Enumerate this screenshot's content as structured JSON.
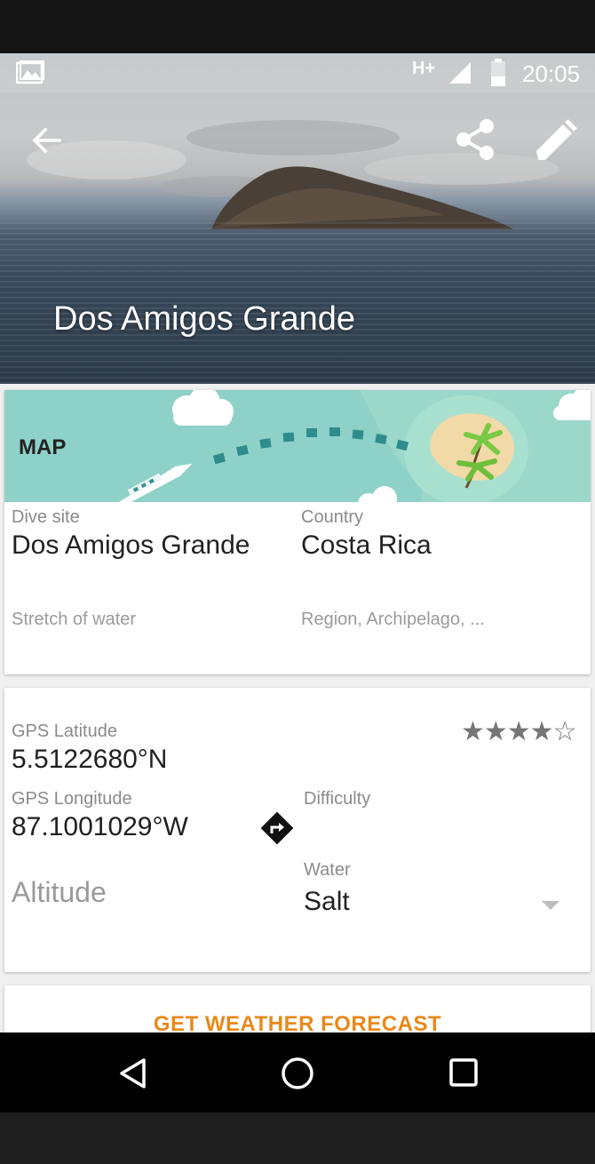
{
  "status": {
    "network": "H+",
    "time": "20:05"
  },
  "hero": {
    "title": "Dos Amigos Grande"
  },
  "map": {
    "label": "MAP"
  },
  "site": {
    "dive_site_label": "Dive site",
    "dive_site_value": "Dos Amigos Grande",
    "country_label": "Country",
    "country_value": "Costa Rica",
    "stretch_placeholder": "Stretch of water",
    "region_placeholder": "Region, Archipelago, ..."
  },
  "gps": {
    "lat_label": "GPS Latitude",
    "lat_value": "5.5122680°N",
    "lon_label": "GPS Longitude",
    "lon_value": "87.1001029°W",
    "altitude_placeholder": "Altitude",
    "rating": 4,
    "rating_max": 5,
    "rating_text": "★★★★☆",
    "difficulty_label": "Difficulty",
    "water_label": "Water",
    "water_value": "Salt"
  },
  "actions": {
    "weather_button": "GET WEATHER FORECAST"
  },
  "colors": {
    "accent": "#e8891a",
    "map_bg": "#8ed1c8",
    "text": "#212121",
    "label": "#8a8a8a"
  }
}
